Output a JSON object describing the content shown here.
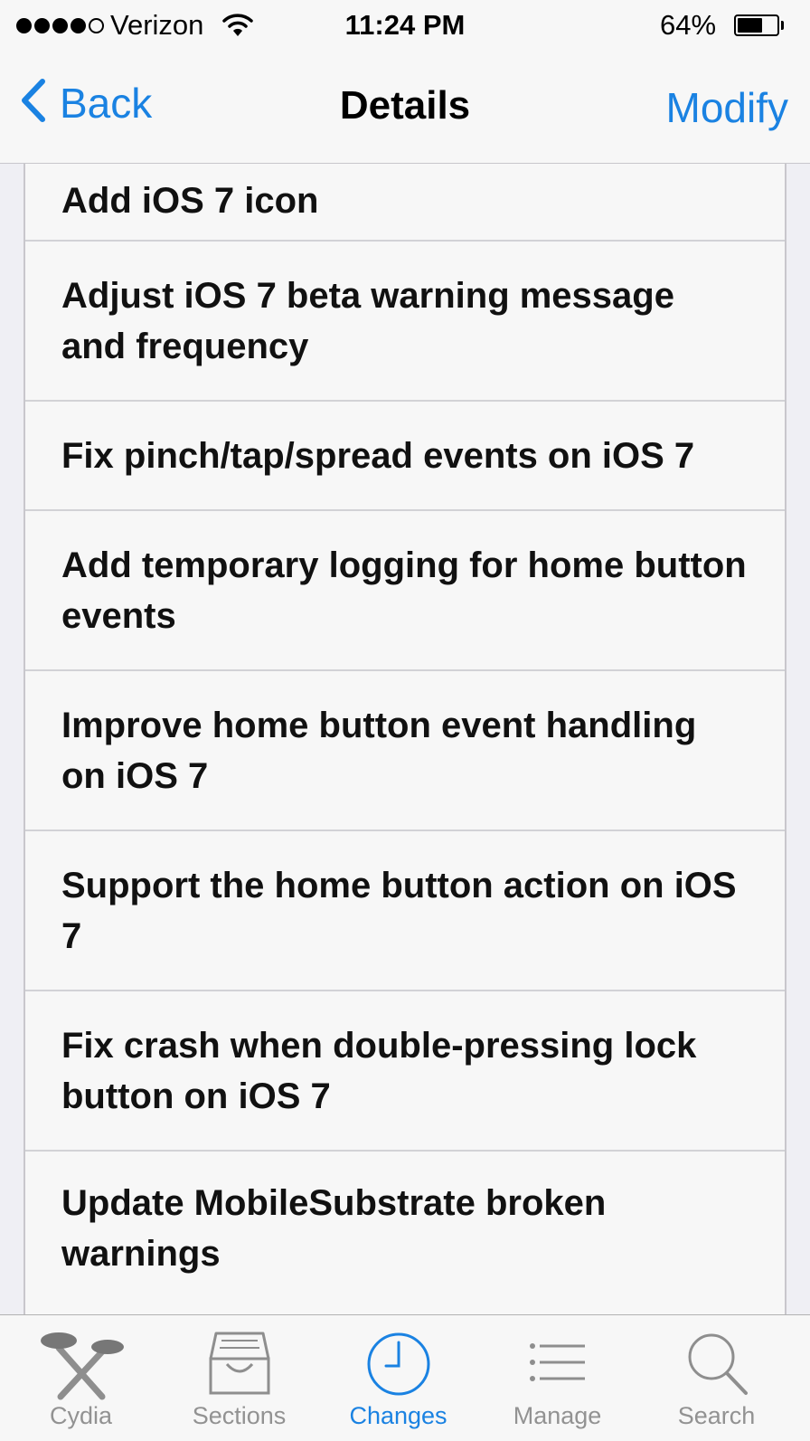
{
  "status_bar": {
    "carrier": "Verizon",
    "time": "11:24 PM",
    "battery_percent": "64%",
    "battery_level": 0.64,
    "signal_bars_filled": 4,
    "signal_bars_total": 5
  },
  "nav_bar": {
    "back_label": "Back",
    "title": "Details",
    "right_button": "Modify"
  },
  "changes": [
    "Add iOS 7 icon",
    "Adjust iOS 7 beta warning message and frequency",
    "Fix pinch/tap/spread events on iOS 7",
    "Add temporary logging for home button events",
    "Improve home button event handling on iOS 7",
    "Support the home button action on iOS 7",
    "Fix crash when double-pressing lock button on iOS 7",
    "Update MobileSubstrate broken warnings"
  ],
  "tab_bar": {
    "tabs": [
      {
        "label": "Cydia",
        "icon": "cydia-icon",
        "active": false
      },
      {
        "label": "Sections",
        "icon": "sections-icon",
        "active": false
      },
      {
        "label": "Changes",
        "icon": "clock-icon",
        "active": true
      },
      {
        "label": "Manage",
        "icon": "list-icon",
        "active": false
      },
      {
        "label": "Search",
        "icon": "search-icon",
        "active": false
      }
    ]
  },
  "colors": {
    "accent": "#1a82e2",
    "inactive_tab": "#929292",
    "bar_background": "#f7f7f7",
    "page_background": "#efeff4"
  }
}
